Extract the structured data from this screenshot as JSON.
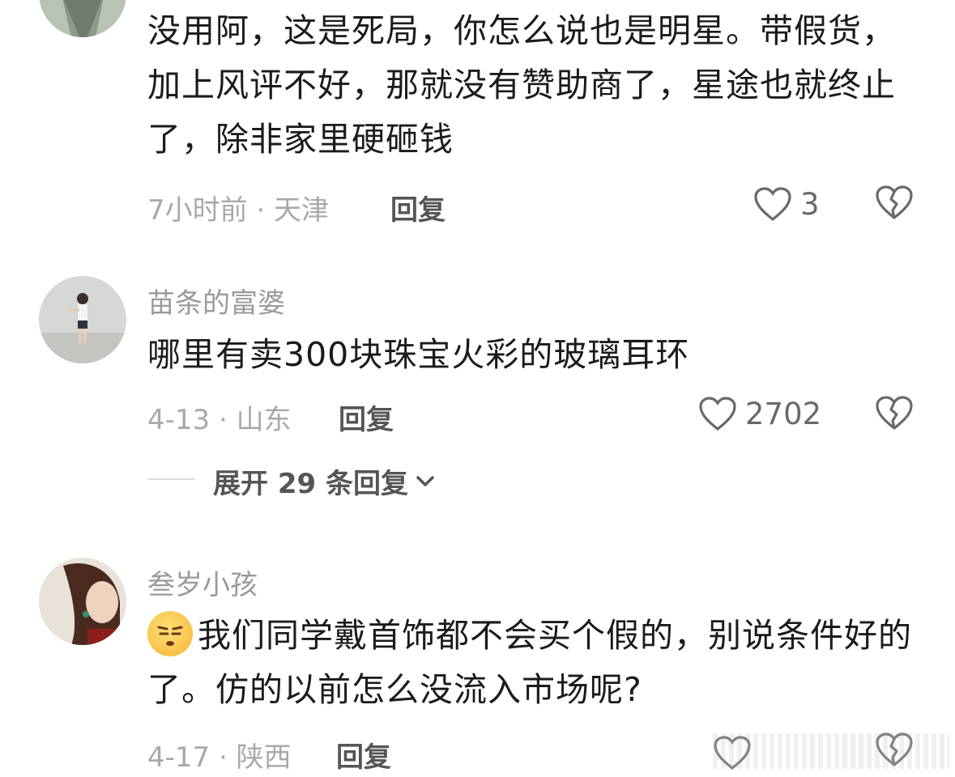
{
  "comments": [
    {
      "text": "没用阿，这是死局，你怎么说也是明星。带假货，加上风评不好，那就没有赞助商了，星途也就终止了，除非家里硬砸钱",
      "meta": "7小时前 · 天津",
      "reply_label": "回复",
      "likes": "3"
    },
    {
      "username": "苗条的富婆",
      "text": "哪里有卖300块珠宝火彩的玻璃耳环",
      "meta": "4-13 · 山东",
      "reply_label": "回复",
      "likes": "2702",
      "expand_label": "展开 29 条回复"
    },
    {
      "username": "叁岁小孩",
      "text": "我们同学戴首饰都不会买个假的，别说条件好的了。仿的以前怎么没流入市场呢?",
      "meta": "4-17 · 陕西",
      "reply_label": "回复"
    }
  ],
  "icons": {
    "like": "heart-outline-icon",
    "dislike": "broken-heart-icon",
    "expand": "chevron-down-icon",
    "emoji": "face-emoji-icon"
  },
  "colors": {
    "text": "#1b1b1b",
    "meta": "#a9a9a9",
    "username": "#9a9a9a"
  }
}
